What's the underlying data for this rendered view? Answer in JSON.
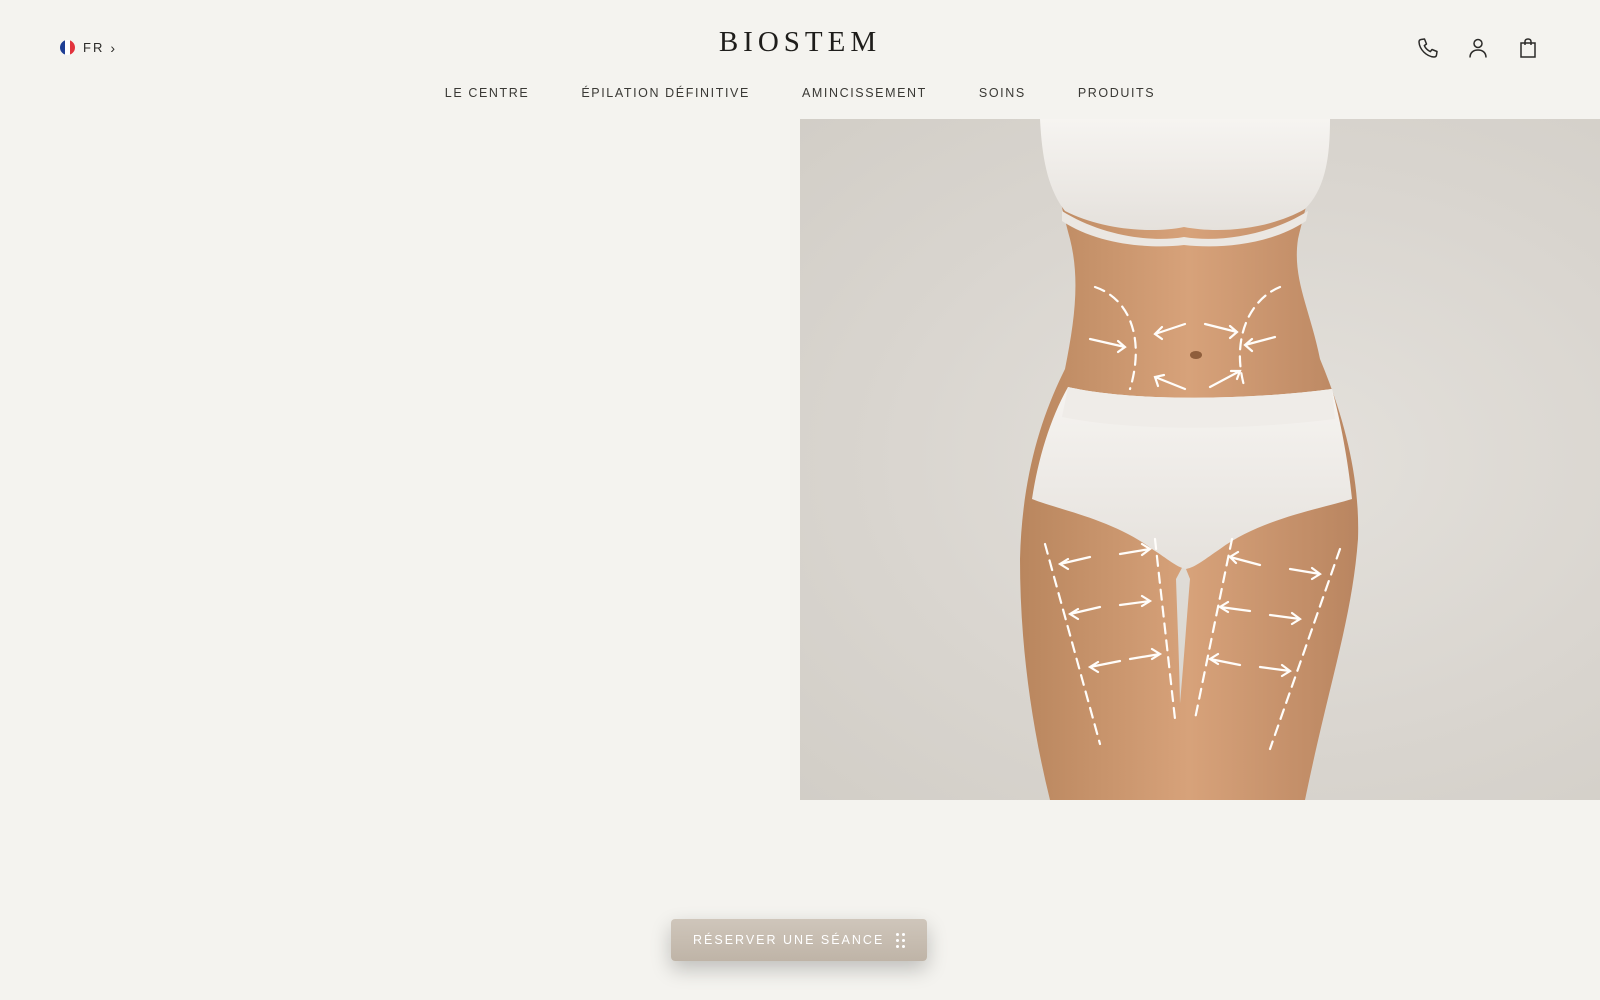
{
  "header": {
    "language": {
      "code": "FR",
      "flag_colors": [
        "#1f3f95",
        "#ffffff",
        "#e2323c"
      ]
    },
    "logo": "BIOSTEM",
    "icons": [
      "phone-icon",
      "user-icon",
      "bag-icon"
    ]
  },
  "nav": {
    "items": [
      {
        "label": "LE CENTRE"
      },
      {
        "label": "ÉPILATION DÉFINITIVE"
      },
      {
        "label": "AMINCISSEMENT"
      },
      {
        "label": "SOINS"
      },
      {
        "label": "PRODUITS"
      }
    ]
  },
  "hero": {
    "image": "body-contouring-photo",
    "background": "#dcd8d2"
  },
  "cta": {
    "label": "RÉSERVER UNE SÉANCE"
  },
  "colors": {
    "page_bg": "#f4f3ef",
    "text": "#2b2a28",
    "cta": "#c7bdb1"
  }
}
